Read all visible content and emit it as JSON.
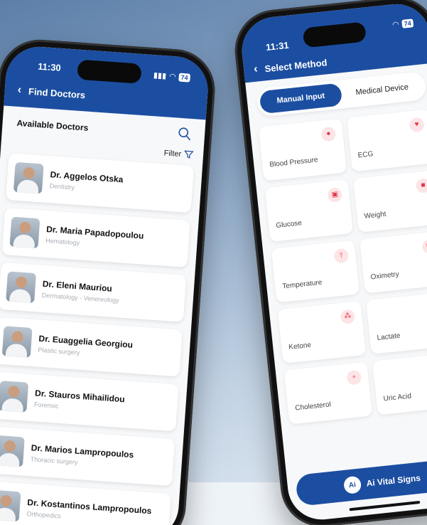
{
  "left_phone": {
    "time": "11:30",
    "battery": "74",
    "title": "Find Doctors",
    "section_title": "Available Doctors",
    "filter_label": "Filter",
    "doctors": [
      {
        "name": "Dr. Aggelos Otska",
        "specialty": "Dentistry"
      },
      {
        "name": "Dr. Maria Papadopoulou",
        "specialty": "Hematology"
      },
      {
        "name": "Dr. Eleni Mauriou",
        "specialty": "Dermatology - Venereology"
      },
      {
        "name": "Dr. Euaggelia Georgiou",
        "specialty": "Plastic surgery"
      },
      {
        "name": "Dr. Stauros Mihailidou",
        "specialty": "Forensic"
      },
      {
        "name": "Dr. Marios Lampropoulos",
        "specialty": "Thoracic surgery"
      },
      {
        "name": "Dr. Kostantinos Lampropoulos",
        "specialty": "Orthopedics"
      }
    ]
  },
  "right_phone": {
    "time": "11:31",
    "battery": "74",
    "title": "Select Method",
    "toggle": {
      "manual": "Manual Input",
      "device": "Medical Device"
    },
    "methods": [
      {
        "label": "Blood Pressure",
        "icon": "drop-icon"
      },
      {
        "label": "ECG",
        "icon": "heart-pulse-icon"
      },
      {
        "label": "Glucose",
        "icon": "glucose-meter-icon"
      },
      {
        "label": "Weight",
        "icon": "scale-icon"
      },
      {
        "label": "Temperature",
        "icon": "thermometer-icon"
      },
      {
        "label": "Oximetry",
        "icon": "oximeter-icon"
      },
      {
        "label": "Ketone",
        "icon": "molecule-icon"
      },
      {
        "label": "Lactate",
        "icon": "stethoscope-icon"
      },
      {
        "label": "Cholesterol",
        "icon": "cells-icon"
      },
      {
        "label": "Uric Acid",
        "icon": "syringe-icon"
      }
    ],
    "brand": {
      "logo_text": "Ai",
      "name": "Ai Vital Signs"
    }
  },
  "colors": {
    "primary": "#1b4ea1",
    "accent_red": "#e23447",
    "icon_bg": "#fde4e6"
  }
}
